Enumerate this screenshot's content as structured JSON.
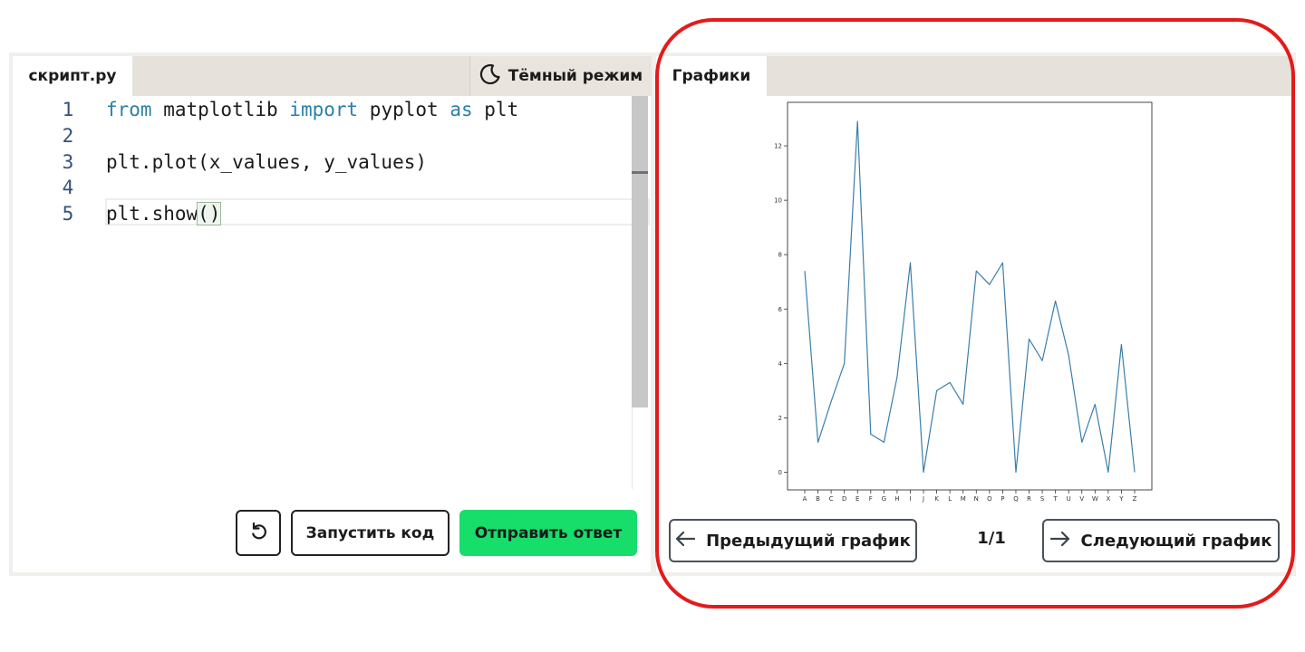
{
  "editor": {
    "file_tab": "скрипт.ру",
    "theme_toggle": "Тёмный режим",
    "lines": [
      {
        "num": "1",
        "parts": [
          {
            "t": "from",
            "k": true
          },
          {
            "t": " matplotlib ",
            "k": false
          },
          {
            "t": "import",
            "k": true
          },
          {
            "t": " pyplot ",
            "k": false
          },
          {
            "t": "as",
            "k": true
          },
          {
            "t": " plt",
            "k": false
          }
        ]
      },
      {
        "num": "2",
        "parts": []
      },
      {
        "num": "3",
        "parts": [
          {
            "t": "plt.plot(x_values, y_values)",
            "k": false
          }
        ]
      },
      {
        "num": "4",
        "parts": []
      },
      {
        "num": "5",
        "parts": [
          {
            "t": "plt.show",
            "k": false
          },
          {
            "t": "()",
            "k": false,
            "b": true
          }
        ]
      }
    ],
    "run_label": "Запустить код",
    "submit_label": "Отправить ответ"
  },
  "graph_panel": {
    "tab": "Графики",
    "prev_label": "Предыдущий график",
    "next_label": "Следующий график",
    "counter": "1/1"
  },
  "colors": {
    "line": "#3a7eab",
    "submit": "#17dd6a",
    "highlight": "#e31b1b"
  },
  "chart_data": {
    "type": "line",
    "x": [
      "A",
      "B",
      "C",
      "D",
      "E",
      "F",
      "G",
      "H",
      "I",
      "J",
      "K",
      "L",
      "M",
      "N",
      "O",
      "P",
      "Q",
      "R",
      "S",
      "T",
      "U",
      "V",
      "W",
      "X",
      "Y",
      "Z"
    ],
    "values": [
      7.4,
      1.1,
      2.6,
      4.0,
      12.9,
      1.4,
      1.1,
      3.5,
      7.7,
      0.0,
      3.0,
      3.3,
      2.5,
      7.4,
      6.9,
      7.7,
      0.0,
      4.9,
      4.1,
      6.3,
      4.3,
      1.1,
      2.5,
      0.0,
      4.7,
      0.0
    ],
    "yticks": [
      0,
      2,
      4,
      6,
      8,
      10,
      12
    ],
    "ylim": [
      -0.65,
      13.6
    ],
    "grid": false,
    "title": "",
    "xlabel": "",
    "ylabel": ""
  }
}
